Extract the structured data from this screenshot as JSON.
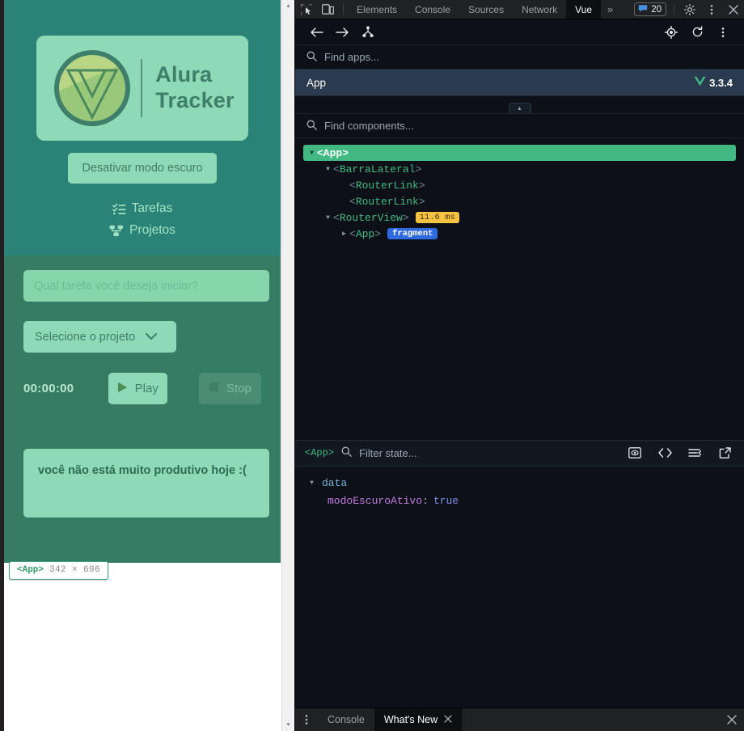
{
  "page": {
    "logo": {
      "title_line1": "Alura",
      "title_line2": "Tracker",
      "alt": "vue-logo"
    },
    "dark_mode_button": "Desativar modo escuro",
    "nav": [
      {
        "label": "Tarefas",
        "icon": "checklist-icon"
      },
      {
        "label": "Projetos",
        "icon": "sitemap-icon"
      }
    ],
    "form": {
      "task_placeholder": "Qual tarefa você deseja iniciar?",
      "task_value": "",
      "project_select_label": "Selecione o projeto",
      "timer": "00:00:00",
      "play_label": "Play",
      "stop_label": "Stop"
    },
    "alert_text": "você não está muito produtivo hoje :(",
    "inspector_tooltip": {
      "tag": "<App>",
      "dimensions": "342 × 696"
    },
    "colors": {
      "sidebar_bg": "#2b8277",
      "content_bg": "#367c64",
      "surface": "#8ed9b6",
      "accent_text": "#3e7f6b",
      "nav_text": "#9fe3c2"
    }
  },
  "devtools": {
    "topbar": {
      "inspect_icon": "inspect-element-icon",
      "device_icon": "device-toolbar-icon",
      "tabs": [
        {
          "label": "Elements",
          "active": false
        },
        {
          "label": "Console",
          "active": false
        },
        {
          "label": "Sources",
          "active": false
        },
        {
          "label": "Network",
          "active": false
        },
        {
          "label": "Vue",
          "active": true
        }
      ],
      "overflow": "»",
      "issues_count": "20",
      "issues_icon": "message-icon",
      "settings_icon": "gear-icon",
      "more_icon": "kebab-menu-icon",
      "close_icon": "close-icon"
    },
    "subbar": {
      "back_icon": "arrow-left-icon",
      "forward_icon": "arrow-right-icon",
      "tree_icon": "component-tree-icon",
      "target_icon": "select-component-icon",
      "refresh_icon": "refresh-icon",
      "more_icon": "kebab-menu-icon"
    },
    "apps": {
      "search_placeholder": "Find apps...",
      "selected": {
        "name": "App",
        "version": "3.3.4",
        "logo": "vue-mark-icon"
      }
    },
    "components": {
      "search_placeholder": "Find components...",
      "tree": [
        {
          "label": "<App>",
          "indent": 0,
          "caret": "down",
          "selected": true,
          "badge": "",
          "badge_type": ""
        },
        {
          "label": "<BarraLateral>",
          "indent": 1,
          "caret": "down",
          "selected": false,
          "badge": "",
          "badge_type": ""
        },
        {
          "label": "<RouterLink>",
          "indent": 2,
          "caret": "none",
          "selected": false,
          "badge": "",
          "badge_type": ""
        },
        {
          "label": "<RouterLink>",
          "indent": 2,
          "caret": "none",
          "selected": false,
          "badge": "",
          "badge_type": ""
        },
        {
          "label": "<RouterView>",
          "indent": 1,
          "caret": "down",
          "selected": false,
          "badge": "11.6 ms",
          "badge_type": "time"
        },
        {
          "label": "<App>",
          "indent": 2,
          "caret": "right",
          "selected": false,
          "badge": "fragment",
          "badge_type": "fragment"
        }
      ]
    },
    "state": {
      "context": "<App>",
      "search_placeholder": "Filter state...",
      "icons": [
        {
          "name": "inspect-dom-icon",
          "glyph": "eye-box"
        },
        {
          "name": "open-in-editor-icon",
          "glyph": "code"
        },
        {
          "name": "collapse-all-icon",
          "glyph": "collapse"
        },
        {
          "name": "open-in-window-icon",
          "glyph": "external"
        }
      ],
      "groups": [
        {
          "name": "data",
          "entries": [
            {
              "key": "modoEscuroAtivo",
              "value": "true"
            }
          ]
        }
      ]
    },
    "drawer": {
      "more_icon": "kebab-menu-icon",
      "tabs": [
        {
          "label": "Console",
          "active": false,
          "closable": false
        },
        {
          "label": "What's New",
          "active": true,
          "closable": true
        }
      ],
      "close_icon": "close-icon"
    }
  }
}
